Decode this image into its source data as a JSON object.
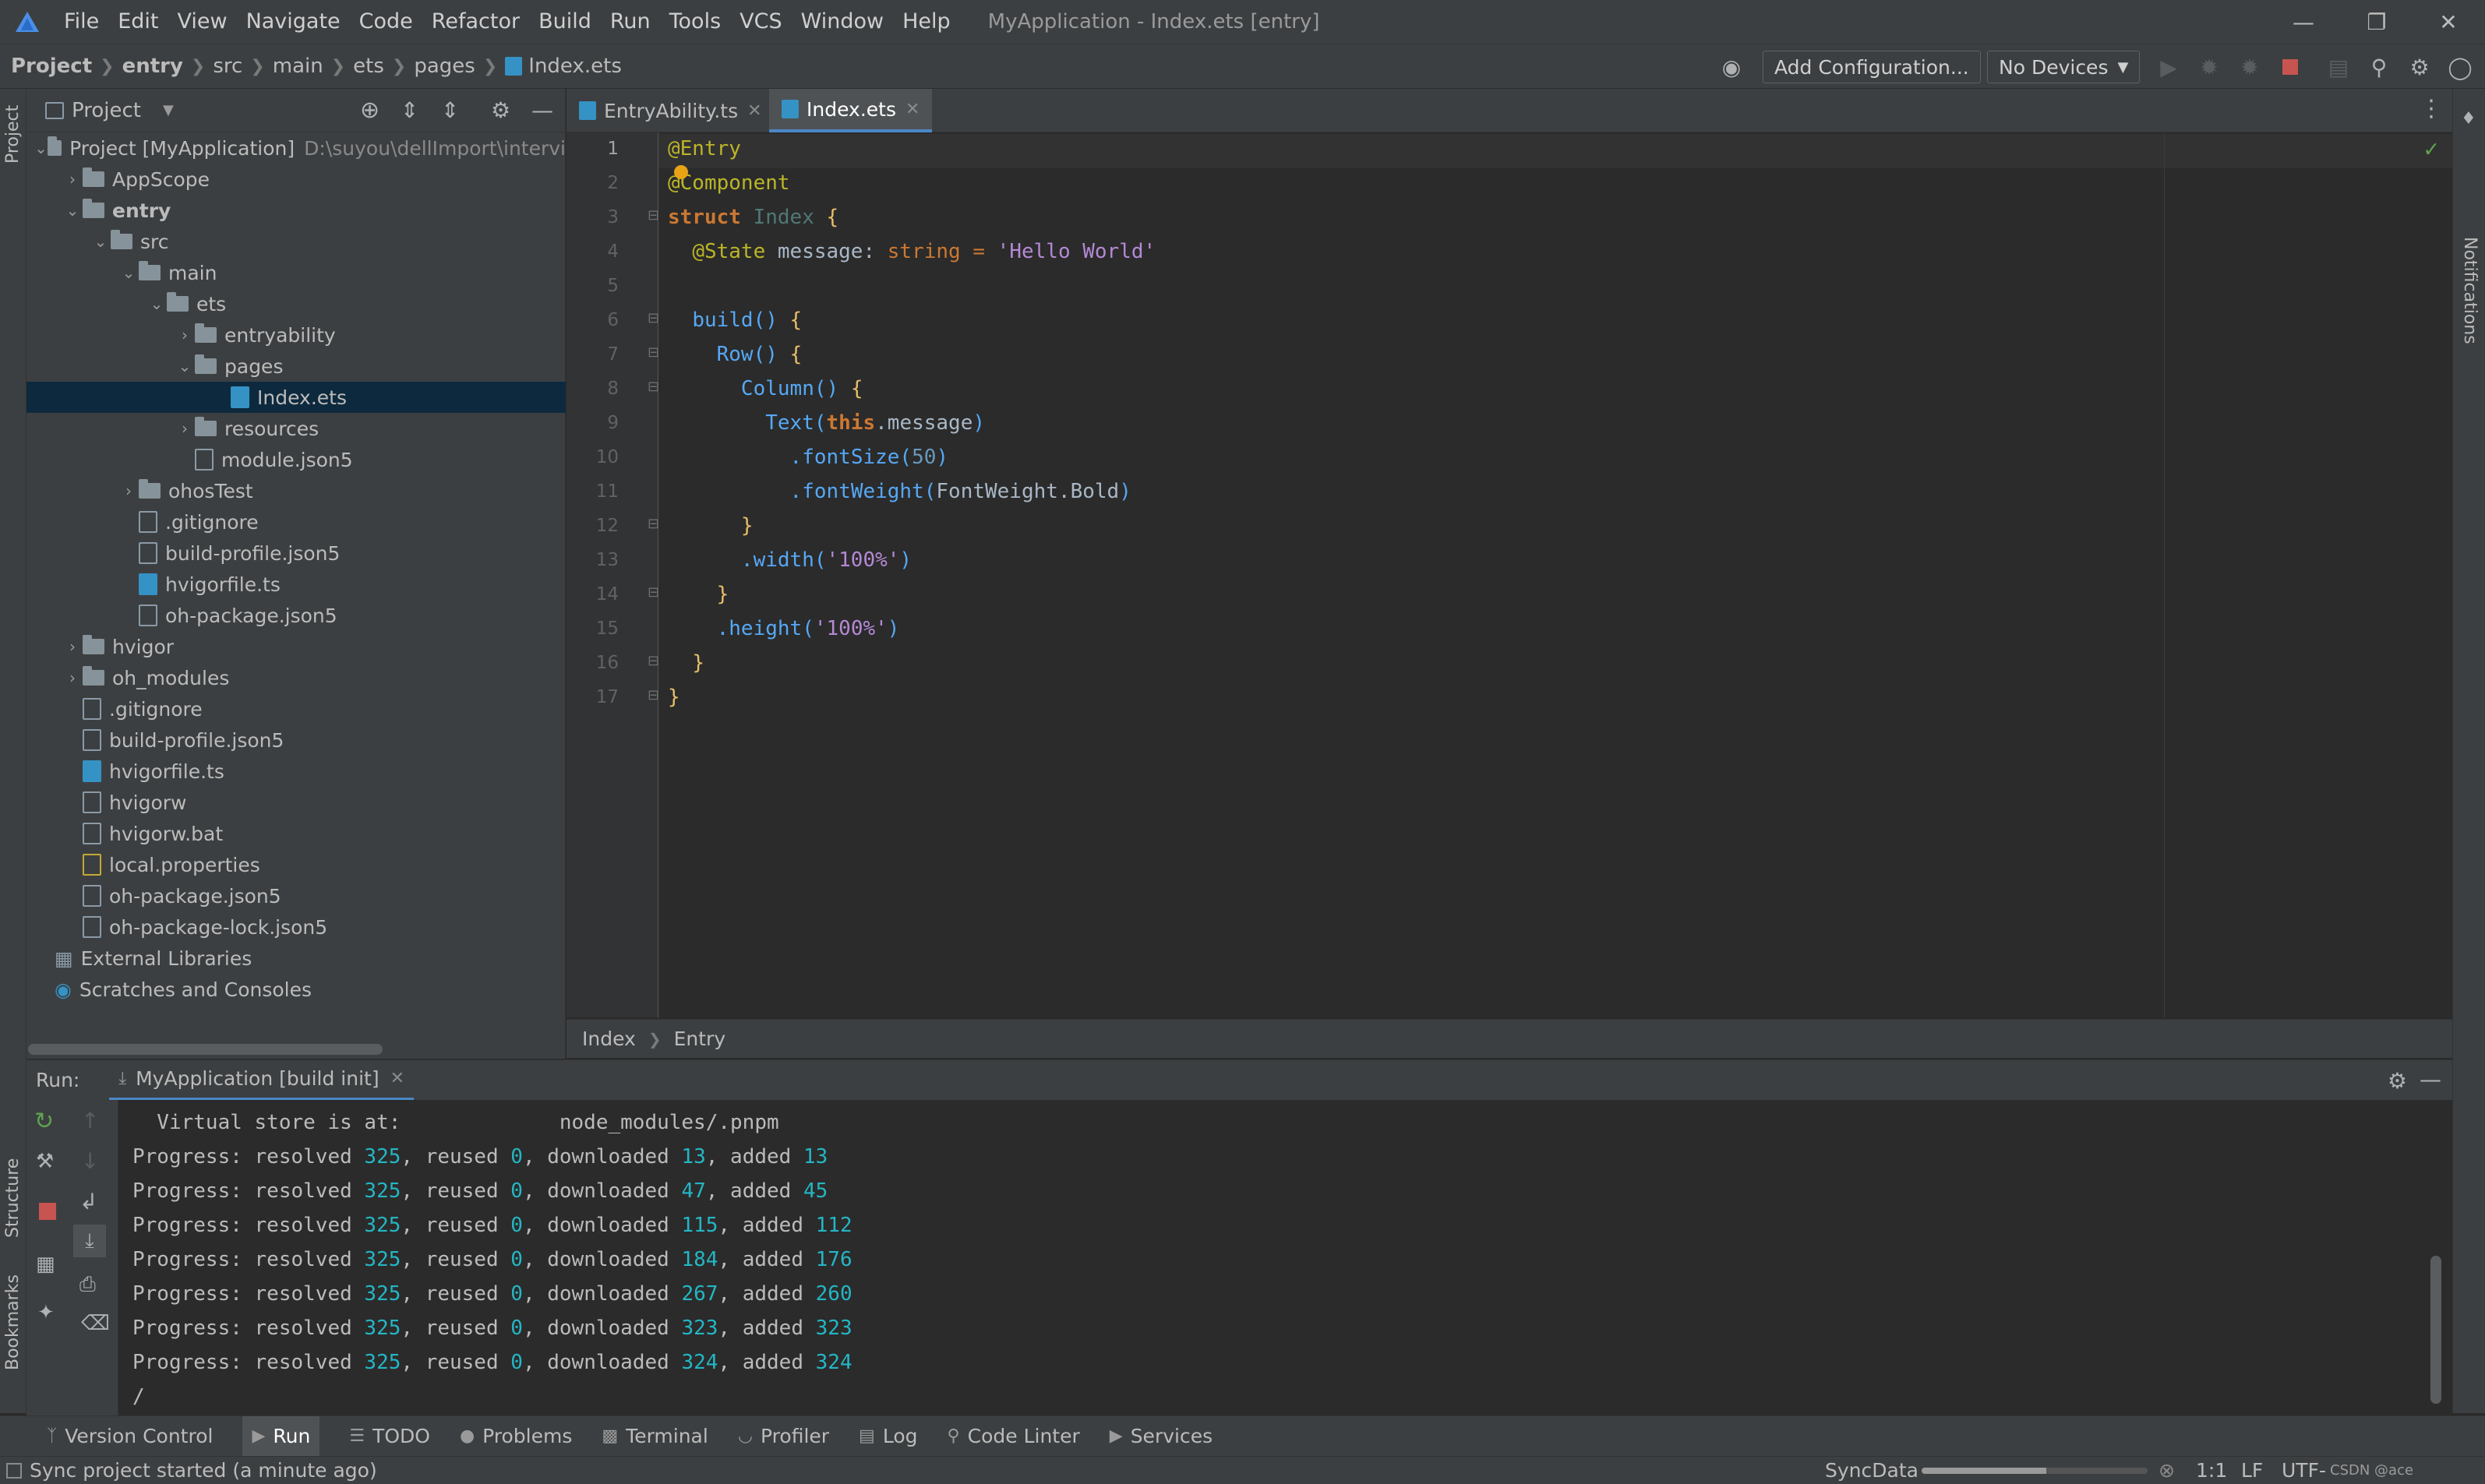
{
  "titlebar": {
    "menus": [
      "File",
      "Edit",
      "View",
      "Navigate",
      "Code",
      "Refactor",
      "Build",
      "Run",
      "Tools",
      "VCS",
      "Window",
      "Help"
    ],
    "title": "MyApplication - Index.ets [entry]"
  },
  "navbar": {
    "crumbs": [
      "Project",
      "entry",
      "src",
      "main",
      "ets",
      "pages",
      "Index.ets"
    ],
    "add_config": "Add Configuration...",
    "devices": "No Devices"
  },
  "left_strip": {
    "project": "Project",
    "structure": "Structure",
    "bookmarks": "Bookmarks"
  },
  "right_strip": {
    "notifications": "Notifications"
  },
  "project_panel": {
    "title": "Project",
    "tree": [
      {
        "label": "Project [MyApplication]",
        "path": "D:\\suyou\\dellImport\\intervi"
      },
      {
        "label": "AppScope"
      },
      {
        "label": "entry"
      },
      {
        "label": "src"
      },
      {
        "label": "main"
      },
      {
        "label": "ets"
      },
      {
        "label": "entryability"
      },
      {
        "label": "pages"
      },
      {
        "label": "Index.ets"
      },
      {
        "label": "resources"
      },
      {
        "label": "module.json5"
      },
      {
        "label": "ohosTest"
      },
      {
        "label": ".gitignore"
      },
      {
        "label": "build-profile.json5"
      },
      {
        "label": "hvigorfile.ts"
      },
      {
        "label": "oh-package.json5"
      },
      {
        "label": "hvigor"
      },
      {
        "label": "oh_modules"
      },
      {
        "label": ".gitignore"
      },
      {
        "label": "build-profile.json5"
      },
      {
        "label": "hvigorfile.ts"
      },
      {
        "label": "hvigorw"
      },
      {
        "label": "hvigorw.bat"
      },
      {
        "label": "local.properties"
      },
      {
        "label": "oh-package.json5"
      },
      {
        "label": "oh-package-lock.json5"
      },
      {
        "label": "External Libraries"
      },
      {
        "label": "Scratches and Consoles"
      }
    ]
  },
  "editor": {
    "tabs": [
      "EntryAbility.ts",
      "Index.ets"
    ],
    "line_numbers": [
      "1",
      "2",
      "3",
      "4",
      "5",
      "6",
      "7",
      "8",
      "9",
      "10",
      "11",
      "12",
      "13",
      "14",
      "15",
      "16",
      "17"
    ],
    "code": {
      "l1": "@Entry",
      "l2": "@Component",
      "l3a": "struct",
      "l3b": "Index",
      "l3c": "{",
      "l4a": "@State",
      "l4b": "message:",
      "l4c": "string",
      "l4d": "=",
      "l4e": "'Hello World'",
      "l6a": "build()",
      "l6b": "{",
      "l7a": "Row()",
      "l7b": "{",
      "l8a": "Column()",
      "l8b": "{",
      "l9a": "Text(",
      "l9b": "this",
      "l9c": ".message",
      "l9d": ")",
      "l10a": ".fontSize(",
      "l10b": "50",
      "l10c": ")",
      "l11a": ".fontWeight(",
      "l11b": "FontWeight.Bold",
      "l11c": ")",
      "l12": "}",
      "l13a": ".width(",
      "l13b": "'100%'",
      "l13c": ")",
      "l14": "}",
      "l15a": ".height(",
      "l15b": "'100%'",
      "l15c": ")",
      "l16": "}",
      "l17": "}"
    },
    "breadcrumb": [
      "Index",
      "Entry"
    ]
  },
  "run_panel": {
    "label": "Run:",
    "tab": "MyApplication [build init]",
    "console": [
      {
        "text": "  Virtual store is at:             node_modules/.pnpm"
      },
      {
        "resolved": "325",
        "reused": "0",
        "downloaded": "13",
        "added": "13"
      },
      {
        "resolved": "325",
        "reused": "0",
        "downloaded": "47",
        "added": "45"
      },
      {
        "resolved": "325",
        "reused": "0",
        "downloaded": "115",
        "added": "112"
      },
      {
        "resolved": "325",
        "reused": "0",
        "downloaded": "184",
        "added": "176"
      },
      {
        "resolved": "325",
        "reused": "0",
        "downloaded": "267",
        "added": "260"
      },
      {
        "resolved": "325",
        "reused": "0",
        "downloaded": "323",
        "added": "323"
      },
      {
        "resolved": "325",
        "reused": "0",
        "downloaded": "324",
        "added": "324"
      },
      {
        "text": "/"
      }
    ],
    "words": {
      "progress": "Progress: resolved ",
      "reused": ", reused ",
      "downloaded": ", downloaded ",
      "added": ", added "
    }
  },
  "toolwindows": [
    "Version Control",
    "Run",
    "TODO",
    "Problems",
    "Terminal",
    "Profiler",
    "Log",
    "Code Linter",
    "Services"
  ],
  "statusbar": {
    "message": "Sync project started (a minute ago)",
    "task": "SyncData",
    "position": "1:1",
    "line_sep": "LF",
    "encoding": "UTF-",
    "watermark": "CSDN @ace"
  }
}
